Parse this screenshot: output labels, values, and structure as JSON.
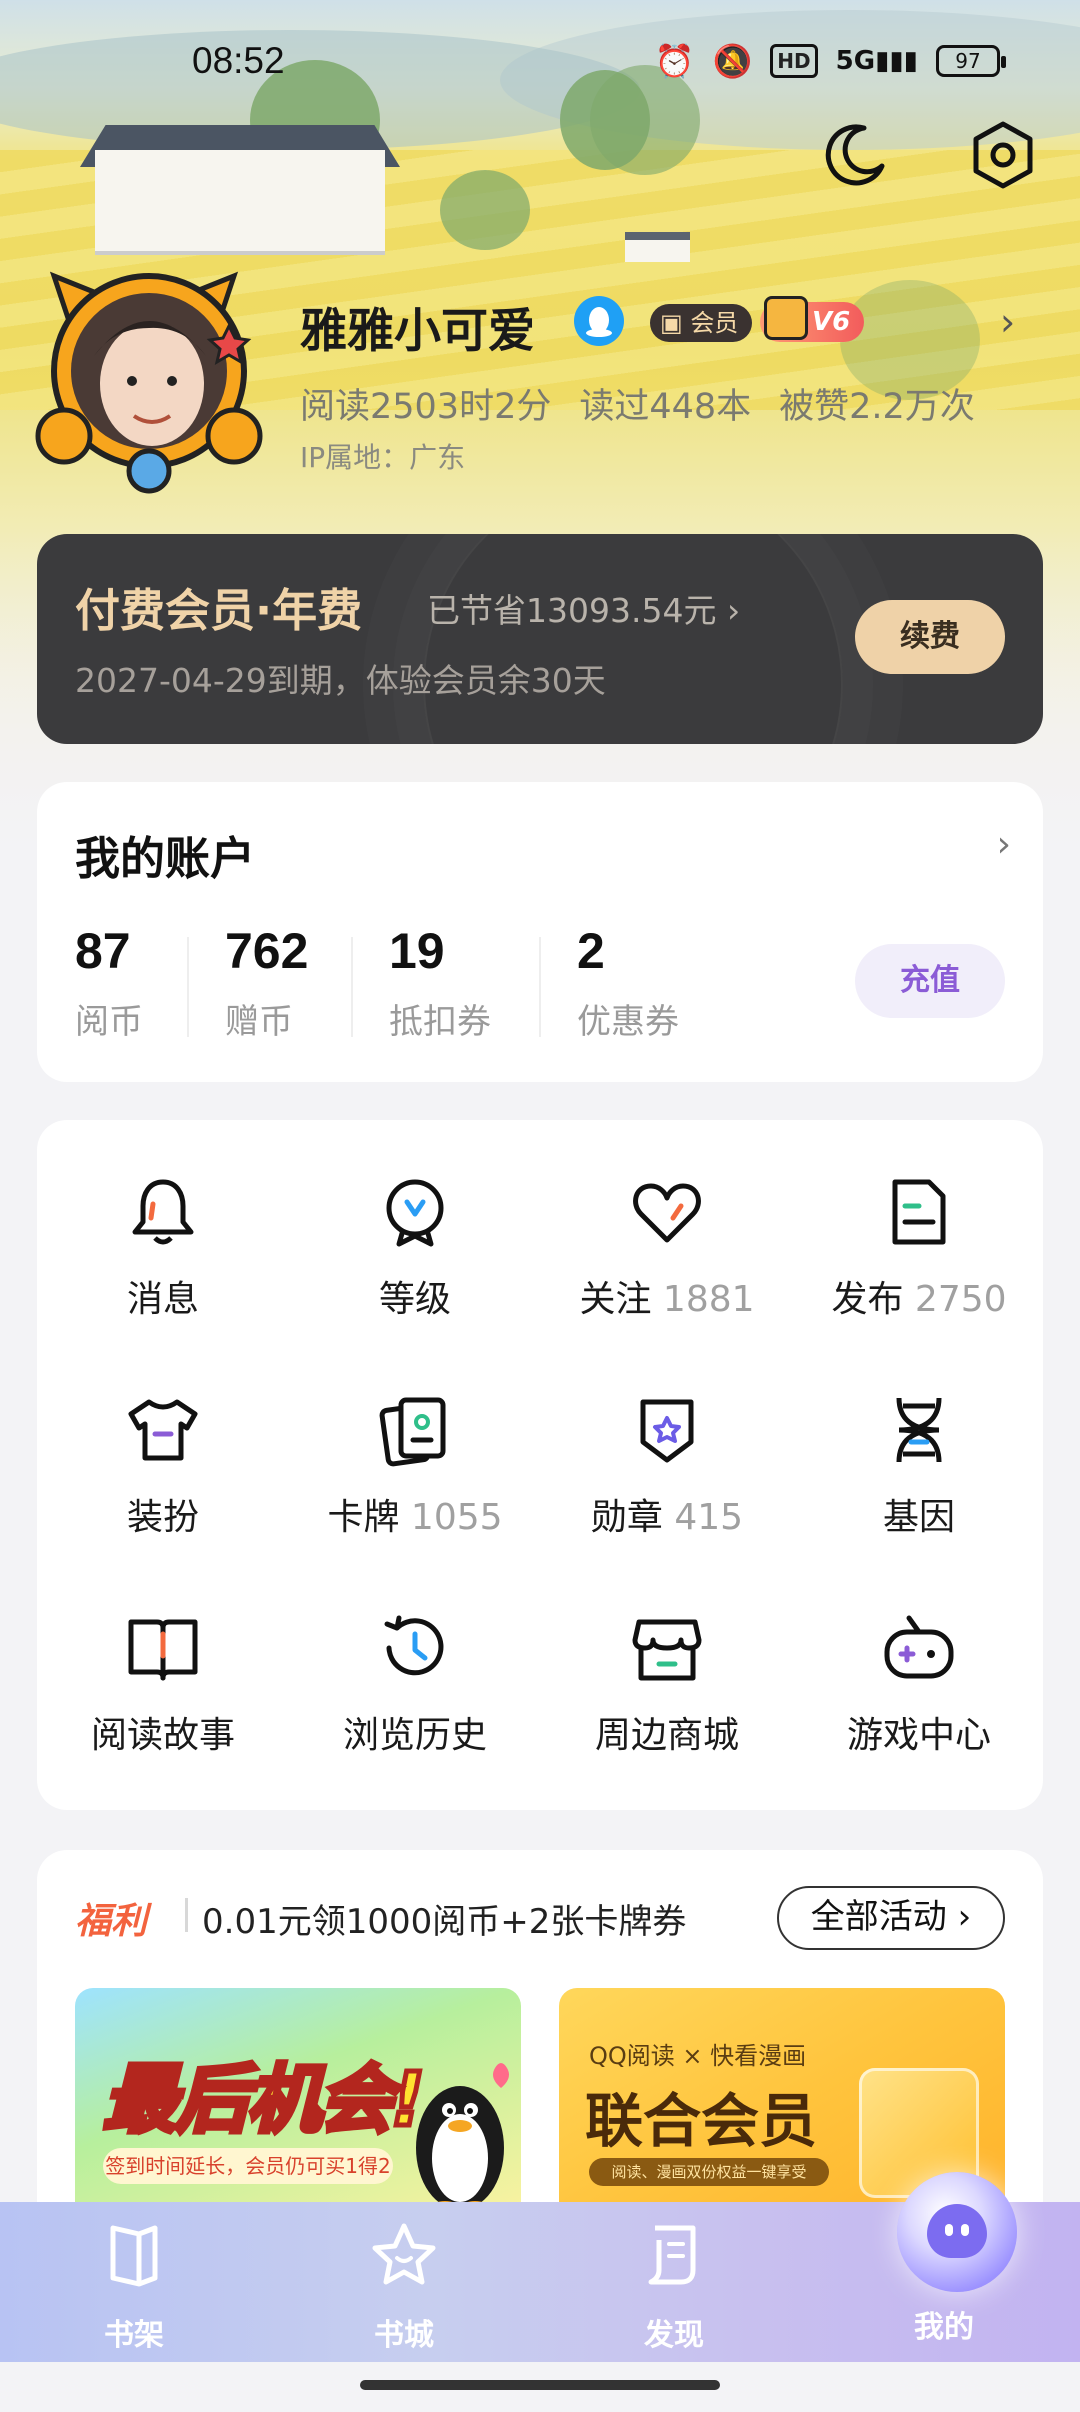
{
  "status_bar": {
    "time": "08:52",
    "network": "5G",
    "hd": "HD",
    "battery": "97"
  },
  "profile": {
    "nickname": "雅雅小可爱",
    "member_badge": "会员",
    "vip_level": "V6",
    "reading_time": "阅读2503时2分",
    "books_read": "读过448本",
    "likes": "被赞2.2万次",
    "ip_location": "IP属地：广东"
  },
  "membership": {
    "title": "付费会员·年费",
    "saved": "已节省13093.54元 ›",
    "expire": "2027-04-29到期，体验会员余30天",
    "renew_label": "续费"
  },
  "account": {
    "title": "我的账户",
    "items": [
      {
        "value": "87",
        "label": "阅币"
      },
      {
        "value": "762",
        "label": "赠币"
      },
      {
        "value": "19",
        "label": "抵扣券"
      },
      {
        "value": "2",
        "label": "优惠券"
      }
    ],
    "recharge_label": "充值"
  },
  "grid": [
    {
      "label": "消息",
      "count": "",
      "icon": "bell-icon"
    },
    {
      "label": "等级",
      "count": "",
      "icon": "level-icon"
    },
    {
      "label": "关注",
      "count": "1881",
      "icon": "heart-icon"
    },
    {
      "label": "发布",
      "count": "2750",
      "icon": "document-icon"
    },
    {
      "label": "装扮",
      "count": "",
      "icon": "shirt-icon"
    },
    {
      "label": "卡牌",
      "count": "1055",
      "icon": "cards-icon"
    },
    {
      "label": "勋章",
      "count": "415",
      "icon": "medal-icon"
    },
    {
      "label": "基因",
      "count": "",
      "icon": "dna-icon"
    },
    {
      "label": "阅读故事",
      "count": "",
      "icon": "book-icon"
    },
    {
      "label": "浏览历史",
      "count": "",
      "icon": "clock-icon"
    },
    {
      "label": "周边商城",
      "count": "",
      "icon": "shop-icon"
    },
    {
      "label": "游戏中心",
      "count": "",
      "icon": "gamepad-icon"
    }
  ],
  "welfare": {
    "tag": "福利",
    "text": "0.01元领1000阅币+2张卡牌券",
    "all_label": "全部活动 ›",
    "banner_left": {
      "title": "最后机会!",
      "subtitle": "签到时间延长，会员仍可买1得2"
    },
    "banner_right": {
      "top": "QQ阅读 × 快看漫画",
      "title": "联合会员",
      "subtitle": "阅读、漫画双份权益一键享受"
    }
  },
  "nav": [
    {
      "label": "书架",
      "icon": "bookshelf-icon"
    },
    {
      "label": "书城",
      "icon": "star-icon"
    },
    {
      "label": "发现",
      "icon": "discover-icon"
    },
    {
      "label": "我的",
      "icon": "mine-orb-icon"
    }
  ],
  "colors": {
    "accent_purple": "#8b5cd6",
    "gold": "#efd2a8",
    "welfare_red": "#f3633e",
    "card_dark": "#3b3b3d"
  }
}
